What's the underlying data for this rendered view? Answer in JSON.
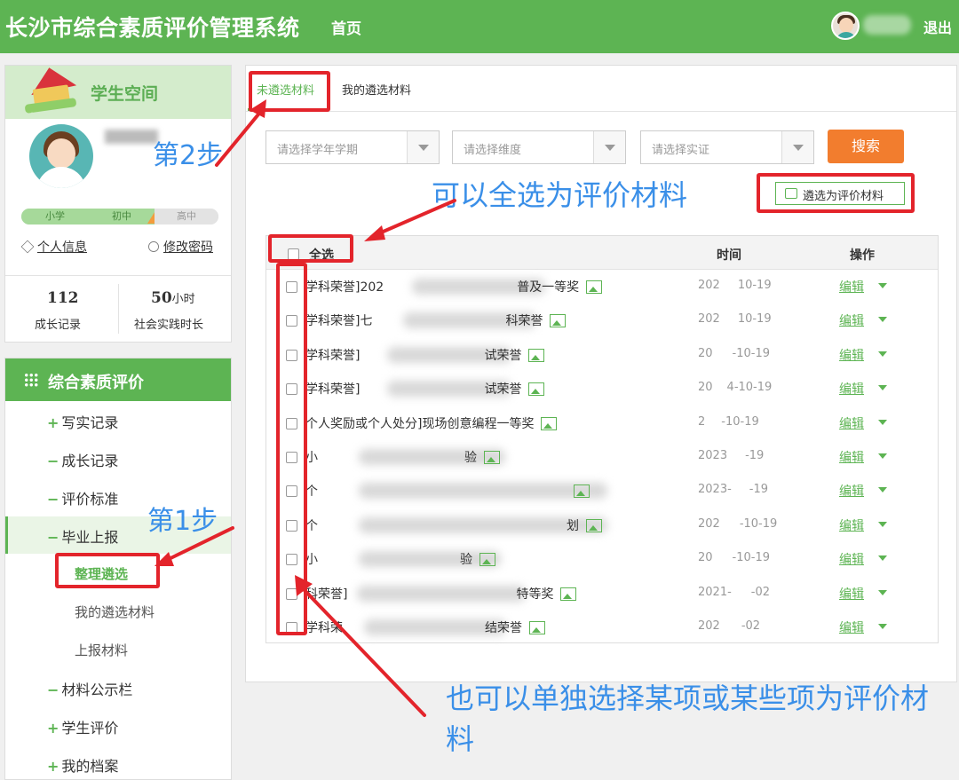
{
  "header": {
    "app_title": "长沙市综合素质评价管理系统",
    "nav_home": "首页",
    "logout": "退出"
  },
  "profile": {
    "space_title": "学生空间",
    "levels": [
      "小学",
      "初中",
      "高中"
    ],
    "personal_info": "个人信息",
    "change_password": "修改密码",
    "growth_records_count": "112",
    "growth_records_label": "成长记录",
    "practice_hours_value": "50",
    "practice_hours_unit": "小时",
    "practice_hours_label": "社会实践时长"
  },
  "menu": {
    "title": "综合素质评价",
    "items": [
      {
        "sign": "+",
        "label": "写实记录"
      },
      {
        "sign": "−",
        "label": "成长记录"
      },
      {
        "sign": "−",
        "label": "评价标准"
      },
      {
        "sign": "−",
        "label": "毕业上报"
      },
      {
        "sign": "−",
        "label": "材料公示栏"
      },
      {
        "sign": "+",
        "label": "学生评价"
      },
      {
        "sign": "+",
        "label": "我的档案"
      }
    ],
    "subitems": [
      "整理遴选",
      "我的遴选材料",
      "上报材料"
    ]
  },
  "tabs": {
    "unselected": "未遴选材料",
    "mine": "我的遴选材料"
  },
  "filters": {
    "term_placeholder": "请选择学年学期",
    "dimension_placeholder": "请选择维度",
    "evidence_placeholder": "请选择实证",
    "search": "搜索",
    "select_as_eval": "遴选为评价材料"
  },
  "table": {
    "col_all": "全选",
    "col_time": "时间",
    "col_op": "操作",
    "edit_label": "编辑",
    "rows": [
      {
        "title": "学科荣誉]202",
        "title2": "普及一等奖",
        "time": "202",
        "time2": "10-19"
      },
      {
        "title": "学科荣誉]七",
        "title2": "科荣誉",
        "time": "202",
        "time2": "10-19"
      },
      {
        "title": "学科荣誉]",
        "title2": "试荣誉",
        "time": "20",
        "time2": "-10-19"
      },
      {
        "title": "学科荣誉]",
        "title2": "试荣誉",
        "time": "20",
        "time2": "4-10-19"
      },
      {
        "title": "个人奖励或个人处分]现场创意编程一等奖",
        "title2": "",
        "time": "2",
        "time2": "-10-19"
      },
      {
        "title": "小",
        "title2": "验",
        "time": "2023",
        "time2": "-19"
      },
      {
        "title": "个",
        "title2": "",
        "time": "2023-",
        "time2": "-19"
      },
      {
        "title": "个",
        "title2": "划",
        "time": "202",
        "time2": "-10-19"
      },
      {
        "title": "小",
        "title2": "验",
        "time": "20",
        "time2": "-10-19"
      },
      {
        "title": "科荣誉]",
        "title2": "特等奖",
        "time": "2021-",
        "time2": "-02"
      },
      {
        "title": "学科荣",
        "title2": "结荣誉",
        "time": "202",
        "time2": "-02"
      }
    ]
  },
  "annotations": {
    "step1": "第1步",
    "step2": "第2步",
    "select_all_hint": "可以全选为评价材料",
    "single_select_hint": "也可以单独选择某项或某些项为评价材料"
  },
  "colors": {
    "brand_green": "#5db453",
    "search_orange": "#f27d2e",
    "annotation_red": "#e3242b",
    "annotation_blue": "#3a8fe8"
  }
}
